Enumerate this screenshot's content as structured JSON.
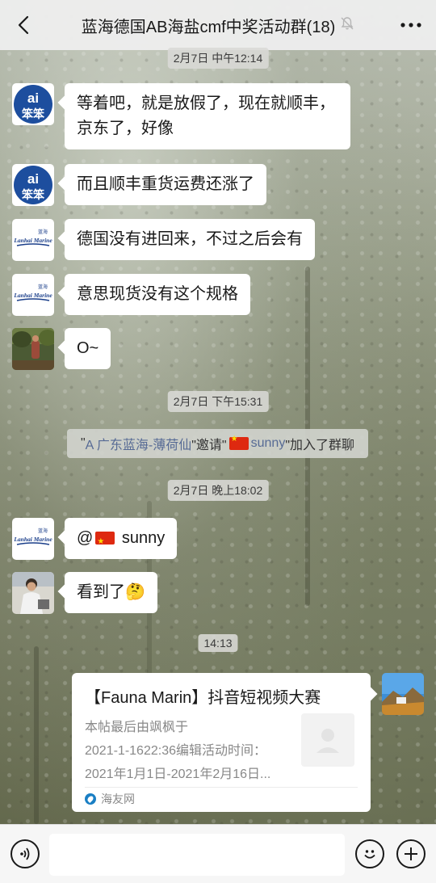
{
  "header": {
    "title": "蓝海德国AB海盐cmf中奖活动群(18)"
  },
  "timestamps": {
    "t1": "2月7日 中午12:14",
    "t2": "2月7日 下午15:31",
    "t3": "2月7日 晚上18:02",
    "t4": "14:13"
  },
  "messages": [
    {
      "avatar": "ai-logo-avatar",
      "lines": [
        "等着吧，就是放假了，现在就顺丰，",
        "京东了，好像"
      ]
    },
    {
      "avatar": "ai-logo-avatar",
      "text": "而且顺丰重货运费还涨了"
    },
    {
      "avatar": "lanhai-marine-avatar",
      "text": "德国没有进回来，不过之后会有"
    },
    {
      "avatar": "lanhai-marine-avatar",
      "text": "意思现货没有这个规格"
    },
    {
      "avatar": "photo-avatar",
      "text": "O~"
    },
    {
      "avatar": "lanhai-marine-avatar",
      "mention": "@",
      "name": "sunny"
    },
    {
      "avatar": "person-avatar",
      "text": "看到了🤔"
    }
  ],
  "system_notice": {
    "open_quote": "\"",
    "inviter": "A 广东蓝海-薄荷仙",
    "invite_word": "\"邀请\"",
    "invitee": "sunny",
    "joined": "\"加入了群聊"
  },
  "link_card": {
    "title": "【Fauna Marin】抖音短视频大赛",
    "desc_lines": [
      "本帖最后由飒枫于",
      "2021-1-1622:36编辑活动时间：",
      "2021年1月1日-2021年2月16日..."
    ],
    "source": "海友网"
  },
  "avatar_text": {
    "ai": "ai",
    "benben": "笨笨",
    "lanhai_cn": "蓝海",
    "lanhai_en": "Lanhai Marine"
  },
  "colors": {
    "link": "#576b95",
    "bubble": "#ffffff",
    "header_bg": "#ededed",
    "flag_red": "#de2910"
  },
  "input": {
    "value": ""
  }
}
